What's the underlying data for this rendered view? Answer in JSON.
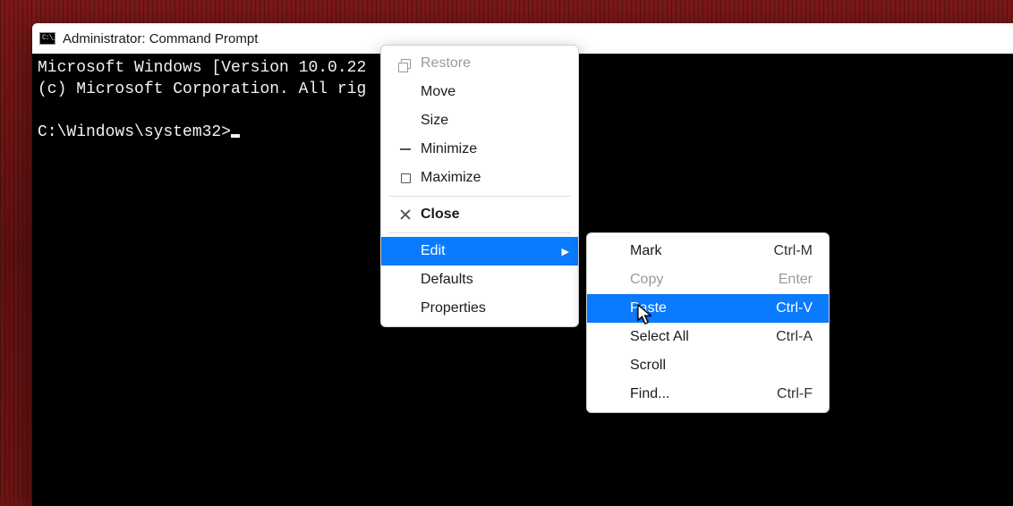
{
  "window": {
    "title": "Administrator: Command Prompt"
  },
  "terminal": {
    "line1": "Microsoft Windows [Version 10.0.22",
    "line2": "(c) Microsoft Corporation. All rig",
    "prompt": "C:\\Windows\\system32>"
  },
  "system_menu": {
    "restore": "Restore",
    "move": "Move",
    "size": "Size",
    "minimize": "Minimize",
    "maximize": "Maximize",
    "close": "Close",
    "edit": "Edit",
    "defaults": "Defaults",
    "properties": "Properties"
  },
  "edit_menu": {
    "mark": {
      "label": "Mark",
      "shortcut": "Ctrl-M"
    },
    "copy": {
      "label": "Copy",
      "shortcut": "Enter"
    },
    "paste": {
      "label": "Paste",
      "shortcut": "Ctrl-V"
    },
    "select_all": {
      "label": "Select All",
      "shortcut": "Ctrl-A"
    },
    "scroll": {
      "label": "Scroll",
      "shortcut": ""
    },
    "find": {
      "label": "Find...",
      "shortcut": "Ctrl-F"
    }
  }
}
